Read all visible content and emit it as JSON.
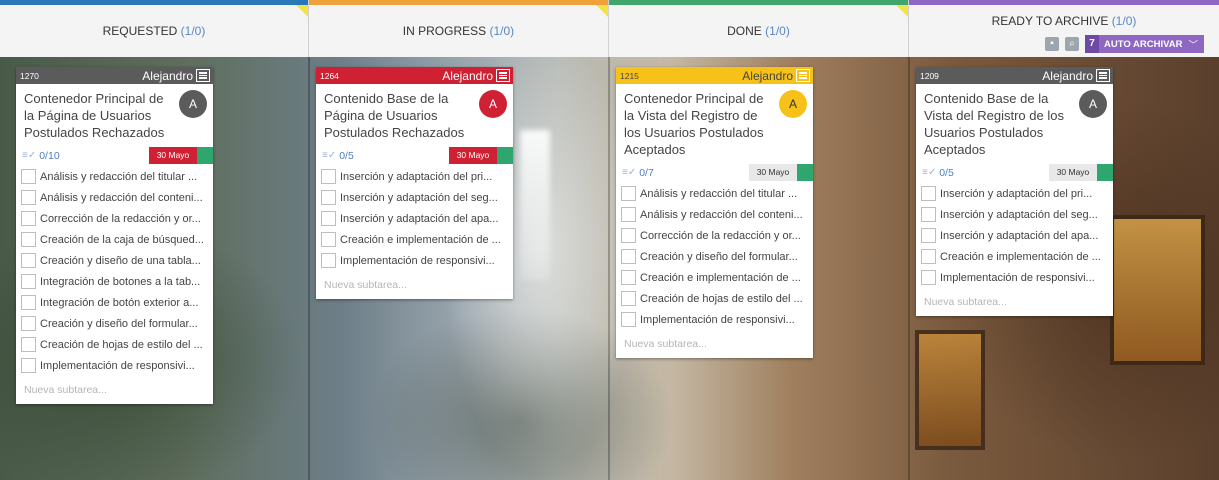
{
  "columns": [
    {
      "title": "REQUESTED",
      "count": "(1/0)",
      "stripe": "#2a78b8"
    },
    {
      "title": "IN PROGRESS",
      "count": "(1/0)",
      "stripe": "#f0a23a"
    },
    {
      "title": "DONE",
      "count": "(1/0)",
      "stripe": "#3fa66c"
    },
    {
      "title": "READY TO ARCHIVE",
      "count": "(1/0)",
      "stripe": "#8e67c2"
    }
  ],
  "archive_tools": {
    "auto_count": "7",
    "auto_label": "AUTO ARCHIVAR",
    "chevron": "﹀",
    "icons": [
      "box-icon",
      "search-icon"
    ]
  },
  "cards": [
    {
      "id": "1270",
      "user": "Alejandro",
      "avatar": "A",
      "color": "gray",
      "title": "Contenedor Principal de la Página de Usuarios Postulados Rechazados",
      "progress": "0/10",
      "date": "30 Mayo",
      "date_style": "red",
      "subtasks": [
        "Análisis y redacción del titular ...",
        "Análisis y redacción del conteni...",
        "Corrección de la redacción y or...",
        "Creación de la caja de búsqued...",
        "Creación y diseño de una tabla...",
        "Integración de botones a la tab...",
        "Integración de botón exterior a...",
        "Creación y diseño del formular...",
        "Creación de hojas de estilo del ...",
        "Implementación de responsivi..."
      ],
      "new_subtask": "Nueva subtarea..."
    },
    {
      "id": "1264",
      "user": "Alejandro",
      "avatar": "A",
      "color": "red",
      "title": "Contenido Base de la Página de Usuarios Postulados Rechazados",
      "progress": "0/5",
      "date": "30 Mayo",
      "date_style": "red",
      "subtasks": [
        "Inserción y adaptación del pri...",
        "Inserción y adaptación del seg...",
        "Inserción y adaptación del apa...",
        "Creación e implementación de ...",
        "Implementación de responsivi..."
      ],
      "new_subtask": "Nueva subtarea..."
    },
    {
      "id": "1215",
      "user": "Alejandro",
      "avatar": "A",
      "color": "yellow",
      "title": "Contenedor Principal de la Vista del Registro de los Usuarios Postulados Aceptados",
      "progress": "0/7",
      "date": "30 Mayo",
      "date_style": "plain",
      "subtasks": [
        "Análisis y redacción del titular ...",
        "Análisis y redacción del conteni...",
        "Corrección de la redacción y or...",
        "Creación y diseño del formular...",
        "Creación e implementación de ...",
        "Creación de hojas de estilo del ...",
        "Implementación de responsivi..."
      ],
      "new_subtask": "Nueva subtarea..."
    },
    {
      "id": "1209",
      "user": "Alejandro",
      "avatar": "A",
      "color": "gray",
      "title": "Contenido Base de la Vista del Registro de los Usuarios Postulados Aceptados",
      "progress": "0/5",
      "date": "30 Mayo",
      "date_style": "plain",
      "subtasks": [
        "Inserción y adaptación del pri...",
        "Inserción y adaptación del seg...",
        "Inserción y adaptación del apa...",
        "Creación e implementación de ...",
        "Implementación de responsivi..."
      ],
      "new_subtask": "Nueva subtarea..."
    }
  ],
  "colors": {
    "card_gray": "#5b5b5b",
    "card_red": "#cf2133",
    "card_yellow": "#f6c21a",
    "done_flag": "#2fa66e",
    "accent_blue": "#4d7fc4"
  }
}
